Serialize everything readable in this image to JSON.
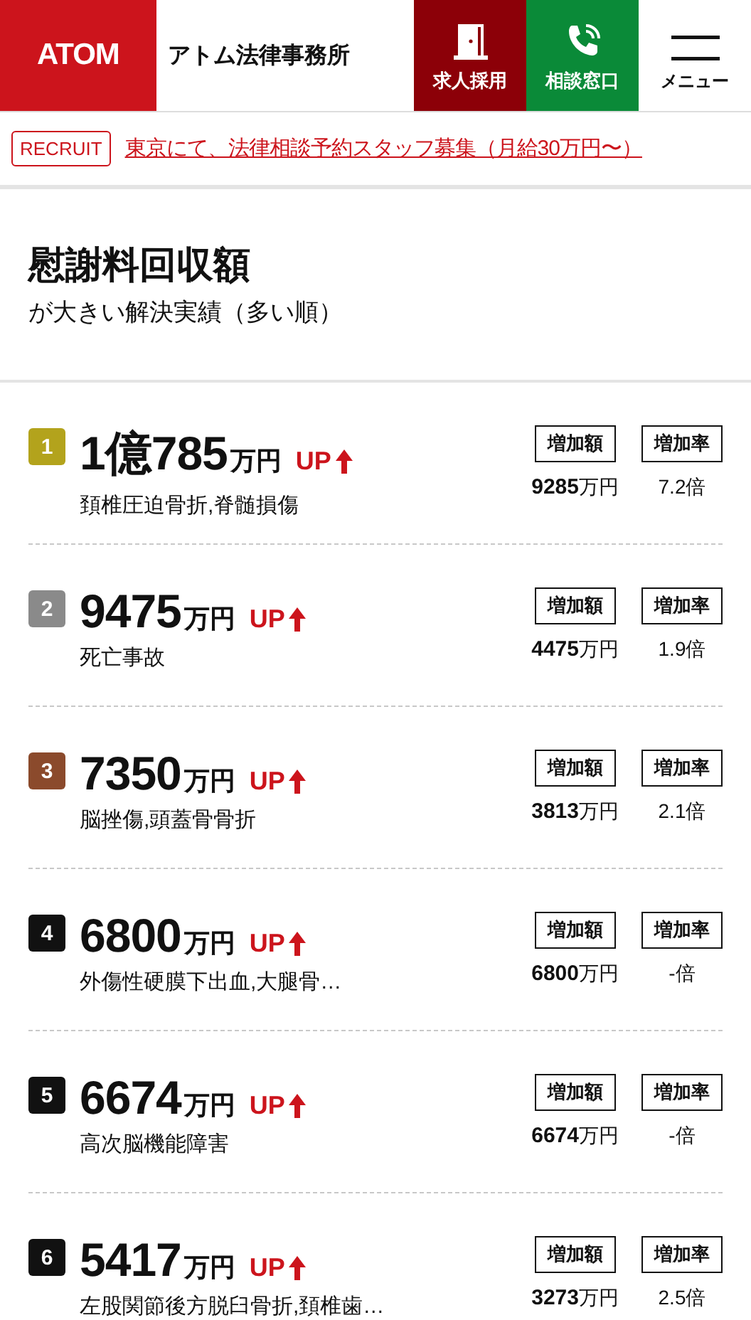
{
  "header": {
    "logo": "ATOM",
    "firm_name": "アトム法律事務所",
    "buttons": [
      {
        "kind": "recruit",
        "label": "求人採用"
      },
      {
        "kind": "consult",
        "label": "相談窓口"
      },
      {
        "kind": "menu",
        "label": "メニュー"
      }
    ]
  },
  "notice": {
    "tag": "RECRUIT",
    "link": "東京にて、法律相談予約スタッフ募集（月給30万円〜）"
  },
  "heading": {
    "title": "慰謝料回収額",
    "subtitle": "が大きい解決実績（多い順）"
  },
  "results": [
    {
      "rank": "1",
      "color": "#b3a31c",
      "amount": "1億785",
      "unit": "万円",
      "up": "UP",
      "injury": "頚椎圧迫骨折,脊髄損傷",
      "increase_label": "増加額",
      "rate_label": "増加率",
      "increase": "9285",
      "increase_unit": "万円",
      "rate": "7.2倍"
    },
    {
      "rank": "2",
      "color": "#8a8a8a",
      "amount": "9475",
      "unit": "万円",
      "up": "UP",
      "injury": "死亡事故",
      "increase_label": "増加額",
      "rate_label": "増加率",
      "increase": "4475",
      "increase_unit": "万円",
      "rate": "1.9倍"
    },
    {
      "rank": "3",
      "color": "#8b4a2c",
      "amount": "7350",
      "unit": "万円",
      "up": "UP",
      "injury": "脳挫傷,頭蓋骨骨折",
      "increase_label": "増加額",
      "rate_label": "増加率",
      "increase": "3813",
      "increase_unit": "万円",
      "rate": "2.1倍"
    },
    {
      "rank": "4",
      "color": "#111111",
      "amount": "6800",
      "unit": "万円",
      "up": "UP",
      "injury": "外傷性硬膜下出血,大腿骨…",
      "increase_label": "増加額",
      "rate_label": "増加率",
      "increase": "6800",
      "increase_unit": "万円",
      "rate": "-倍"
    },
    {
      "rank": "5",
      "color": "#111111",
      "amount": "6674",
      "unit": "万円",
      "up": "UP",
      "injury": "高次脳機能障害",
      "increase_label": "増加額",
      "rate_label": "増加率",
      "increase": "6674",
      "increase_unit": "万円",
      "rate": "-倍"
    },
    {
      "rank": "6",
      "color": "#111111",
      "amount": "5417",
      "unit": "万円",
      "up": "UP",
      "injury": "左股関節後方脱臼骨折,頚椎歯…",
      "increase_label": "増加額",
      "rate_label": "増加率",
      "increase": "3273",
      "increase_unit": "万円",
      "rate": "2.5倍"
    }
  ]
}
